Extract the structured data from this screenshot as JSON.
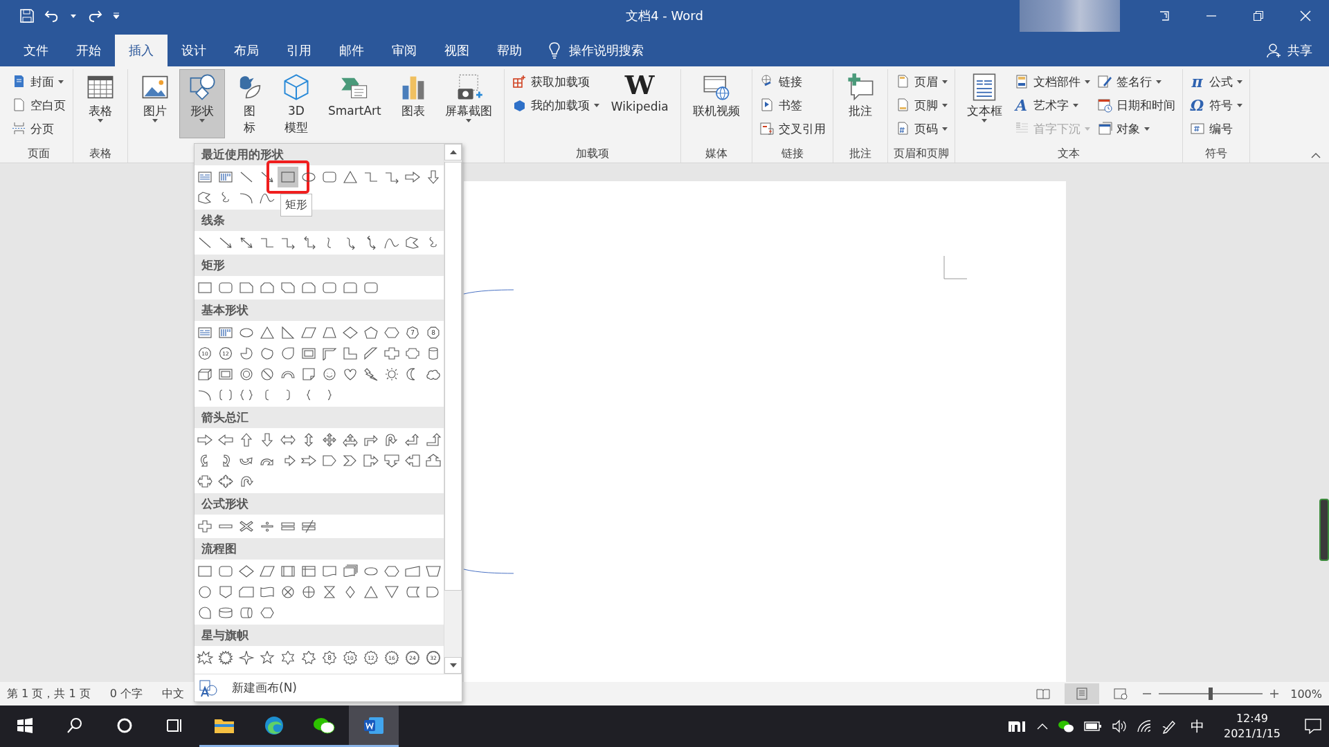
{
  "title_bar": {
    "title": "文档4 - Word"
  },
  "tabs": [
    {
      "label": "文件",
      "selected": false
    },
    {
      "label": "开始",
      "selected": false
    },
    {
      "label": "插入",
      "selected": true
    },
    {
      "label": "设计",
      "selected": false
    },
    {
      "label": "布局",
      "selected": false
    },
    {
      "label": "引用",
      "selected": false
    },
    {
      "label": "邮件",
      "selected": false
    },
    {
      "label": "审阅",
      "selected": false
    },
    {
      "label": "视图",
      "selected": false
    },
    {
      "label": "帮助",
      "selected": false
    }
  ],
  "tell_me": {
    "label": "操作说明搜索"
  },
  "share": {
    "label": "共享"
  },
  "ribbon": {
    "groups": [
      {
        "label": "页面",
        "columns": [
          {
            "items": [
              {
                "label": "封面",
                "kind": "document",
                "dropdown": true,
                "disabled": false
              },
              {
                "label": "空白页",
                "kind": "blank-page",
                "dropdown": false,
                "disabled": false
              },
              {
                "label": "分页",
                "kind": "page-break",
                "dropdown": false,
                "disabled": false
              }
            ]
          }
        ]
      },
      {
        "label": "表格",
        "columns": [
          {
            "kind": "grid",
            "label": "表格",
            "dropdown": true,
            "pressed": false
          }
        ]
      },
      {
        "columns": [
          {
            "kind": "landscape",
            "label": "图片",
            "dropdown": true,
            "pressed": false
          },
          {
            "kind": "shapes",
            "label": "形状",
            "dropdown": true,
            "pressed": true
          },
          {
            "kind": "bird",
            "lines": [
              "图",
              "标"
            ],
            "dropdown": false,
            "pressed": false
          },
          {
            "kind": "cube",
            "lines": [
              "3D",
              "模型"
            ],
            "dropdown": false,
            "pressed": false
          },
          {
            "kind": "diagram",
            "label": "SmartArt",
            "dropdown": false,
            "pressed": false
          },
          {
            "kind": "bar-chart",
            "label": "图表",
            "dropdown": false,
            "pressed": false
          },
          {
            "kind": "camera",
            "label": "屏幕截图",
            "dropdown": true,
            "pressed": false
          }
        ]
      },
      {
        "label": "加载项",
        "columns": [
          {
            "items": [
              {
                "label": "获取加载项",
                "kind": "store",
                "dropdown": false,
                "disabled": false
              },
              {
                "label": "我的加载项",
                "kind": "blocks",
                "dropdown": true,
                "disabled": false
              }
            ]
          },
          {
            "kind": "glyph",
            "glyph": "W",
            "label": "Wikipedia",
            "dropdown": false,
            "pressed": false
          }
        ]
      },
      {
        "label": "媒体",
        "columns": [
          {
            "kind": "film-globe",
            "label": "联机视频",
            "dropdown": false,
            "pressed": false
          }
        ]
      },
      {
        "label": "链接",
        "columns": [
          {
            "items": [
              {
                "label": "链接",
                "kind": "globe-link",
                "dropdown": false,
                "disabled": false
              },
              {
                "label": "书签",
                "kind": "bookmark",
                "dropdown": false,
                "disabled": false
              },
              {
                "label": "交叉引用",
                "kind": "cross-reference",
                "dropdown": false,
                "disabled": false
              }
            ]
          }
        ]
      },
      {
        "label": "批注",
        "columns": [
          {
            "kind": "comment-plus",
            "label": "批注",
            "dropdown": false,
            "pressed": false
          }
        ]
      },
      {
        "label": "页眉和页脚",
        "columns": [
          {
            "items": [
              {
                "label": "页眉",
                "kind": "page-header",
                "dropdown": true,
                "disabled": false
              },
              {
                "label": "页脚",
                "kind": "page-footer",
                "dropdown": true,
                "disabled": false
              },
              {
                "label": "页码",
                "kind": "page-number",
                "dropdown": true,
                "disabled": false
              }
            ]
          }
        ]
      },
      {
        "label": "文本",
        "columns": [
          {
            "kind": "text-box",
            "label": "文本框",
            "dropdown": true,
            "pressed": false
          },
          {
            "items": [
              {
                "label": "文档部件",
                "kind": "page-parts",
                "dropdown": true,
                "disabled": false
              },
              {
                "label": "艺术字",
                "kind": "glyph",
                "glyph": "A",
                "dropdown": true,
                "disabled": false
              },
              {
                "label": "首字下沉",
                "kind": "drop-cap",
                "dropdown": true,
                "disabled": true
              }
            ]
          },
          {
            "items": [
              {
                "label": "签名行",
                "kind": "pen",
                "dropdown": true,
                "disabled": false
              },
              {
                "label": "日期和时间",
                "kind": "calendar",
                "dropdown": false,
                "disabled": false
              },
              {
                "label": "对象",
                "kind": "window",
                "dropdown": true,
                "disabled": false
              }
            ]
          }
        ]
      },
      {
        "label": "符号",
        "columns": [
          {
            "items": [
              {
                "label": "公式",
                "kind": "glyph",
                "glyph": "π",
                "dropdown": true,
                "disabled": false
              },
              {
                "label": "符号",
                "kind": "glyph",
                "glyph": "Ω",
                "dropdown": true,
                "disabled": false
              },
              {
                "label": "编号",
                "kind": "number-box",
                "dropdown": false,
                "disabled": false
              }
            ]
          }
        ]
      }
    ]
  },
  "shapes_menu": {
    "tooltip": "矩形",
    "footer": "新建画布(N)",
    "sections": [
      {
        "title": "最近使用的形状",
        "shapes": [
          {
            "kind": "textbox",
            "selected": false
          },
          {
            "kind": "vtextbox",
            "selected": false
          },
          {
            "kind": "line",
            "selected": false
          },
          {
            "kind": "arrow-line",
            "selected": false
          },
          {
            "kind": "rect",
            "selected": true
          },
          {
            "kind": "oval",
            "selected": false
          },
          {
            "kind": "rounded-rect",
            "selected": false
          },
          {
            "kind": "triangle",
            "selected": false
          },
          {
            "kind": "elbow",
            "selected": false
          },
          {
            "kind": "elbow-arrow",
            "selected": false
          },
          {
            "kind": "right-arrow",
            "selected": false
          },
          {
            "kind": "down-arrow",
            "selected": false
          },
          {
            "kind": "freeform",
            "selected": false
          },
          {
            "kind": "scribble",
            "selected": false
          },
          {
            "kind": "arc",
            "selected": false
          },
          {
            "kind": "curve",
            "selected": false
          }
        ]
      },
      {
        "title": "线条",
        "shapes": [
          {
            "kind": "line",
            "selected": false
          },
          {
            "kind": "arrow-line",
            "selected": false
          },
          {
            "kind": "double-arrow-line",
            "selected": false
          },
          {
            "kind": "elbow",
            "selected": false
          },
          {
            "kind": "elbow-arrow",
            "selected": false
          },
          {
            "kind": "elbow-double-arrow",
            "selected": false
          },
          {
            "kind": "curve-conn",
            "selected": false
          },
          {
            "kind": "curve-arrow",
            "selected": false
          },
          {
            "kind": "curve-double-arrow",
            "selected": false
          },
          {
            "kind": "curve",
            "selected": false
          },
          {
            "kind": "freeform",
            "selected": false
          },
          {
            "kind": "scribble",
            "selected": false
          }
        ]
      },
      {
        "title": "矩形",
        "shapes": [
          {
            "kind": "rect",
            "selected": false
          },
          {
            "kind": "rounded-rect",
            "selected": false
          },
          {
            "kind": "snip1",
            "selected": false
          },
          {
            "kind": "snip2",
            "selected": false
          },
          {
            "kind": "snip-diag",
            "selected": false
          },
          {
            "kind": "snip-round",
            "selected": false
          },
          {
            "kind": "rounded-rect",
            "selected": false
          },
          {
            "kind": "round2",
            "selected": false
          },
          {
            "kind": "rounded-rect",
            "selected": false
          }
        ]
      },
      {
        "title": "基本形状",
        "shapes": [
          {
            "kind": "textbox",
            "selected": false
          },
          {
            "kind": "vtextbox",
            "selected": false
          },
          {
            "kind": "oval",
            "selected": false
          },
          {
            "kind": "triangle",
            "selected": false
          },
          {
            "kind": "right-triangle",
            "selected": false
          },
          {
            "kind": "parallelogram",
            "selected": false
          },
          {
            "kind": "trapezoid",
            "selected": false
          },
          {
            "kind": "diamond",
            "selected": false
          },
          {
            "kind": "pentagon",
            "selected": false
          },
          {
            "kind": "hexagon",
            "selected": false
          },
          {
            "kind": "heptagon",
            "label": "7",
            "selected": false
          },
          {
            "kind": "octagon",
            "label": "8",
            "selected": false
          },
          {
            "kind": "decagon",
            "label": "10",
            "selected": false
          },
          {
            "kind": "dodecagon",
            "label": "12",
            "selected": false
          },
          {
            "kind": "pie",
            "selected": false
          },
          {
            "kind": "chord",
            "selected": false
          },
          {
            "kind": "teardrop",
            "selected": false
          },
          {
            "kind": "frame",
            "selected": false
          },
          {
            "kind": "half-frame",
            "selected": false
          },
          {
            "kind": "l-shape",
            "selected": false
          },
          {
            "kind": "diag-stripe",
            "selected": false
          },
          {
            "kind": "cross",
            "selected": false
          },
          {
            "kind": "plaque",
            "selected": false
          },
          {
            "kind": "can",
            "selected": false
          },
          {
            "kind": "cube",
            "selected": false
          },
          {
            "kind": "bevel",
            "selected": false
          },
          {
            "kind": "donut",
            "selected": false
          },
          {
            "kind": "no-symbol",
            "selected": false
          },
          {
            "kind": "block-arc",
            "selected": false
          },
          {
            "kind": "folded-corner",
            "selected": false
          },
          {
            "kind": "smiley",
            "selected": false
          },
          {
            "kind": "heart",
            "selected": false
          },
          {
            "kind": "lightning",
            "selected": false
          },
          {
            "kind": "sun",
            "selected": false
          },
          {
            "kind": "moon",
            "selected": false
          },
          {
            "kind": "cloud",
            "selected": false
          },
          {
            "kind": "arc",
            "selected": false
          },
          {
            "kind": "bracket-pair",
            "selected": false
          },
          {
            "kind": "brace-pair",
            "selected": false
          },
          {
            "kind": "left-bracket",
            "selected": false
          },
          {
            "kind": "right-bracket",
            "selected": false
          },
          {
            "kind": "left-brace",
            "selected": false
          },
          {
            "kind": "right-brace",
            "selected": false
          }
        ]
      },
      {
        "title": "箭头总汇",
        "shapes": [
          {
            "kind": "right-arrow",
            "selected": false
          },
          {
            "kind": "left-arrow",
            "selected": false
          },
          {
            "kind": "up-arrow",
            "selected": false
          },
          {
            "kind": "down-arrow",
            "selected": false
          },
          {
            "kind": "left-right-arrow",
            "selected": false
          },
          {
            "kind": "up-down-arrow",
            "selected": false
          },
          {
            "kind": "quad-arrow",
            "selected": false
          },
          {
            "kind": "left-right-up-arrow",
            "selected": false
          },
          {
            "kind": "bent-arrow",
            "selected": false
          },
          {
            "kind": "u-turn-arrow",
            "selected": false
          },
          {
            "kind": "left-up-arrow",
            "selected": false
          },
          {
            "kind": "bent-up-arrow",
            "selected": false
          },
          {
            "kind": "curved-right-arrow",
            "selected": false
          },
          {
            "kind": "curved-left-arrow",
            "selected": false
          },
          {
            "kind": "curved-up-arrow",
            "selected": false
          },
          {
            "kind": "curved-down-arrow",
            "selected": false
          },
          {
            "kind": "striped-right-arrow",
            "selected": false
          },
          {
            "kind": "notched-right-arrow",
            "selected": false
          },
          {
            "kind": "pentagon-arrow",
            "selected": false
          },
          {
            "kind": "chevron",
            "selected": false
          },
          {
            "kind": "right-callout",
            "selected": false
          },
          {
            "kind": "down-callout",
            "selected": false
          },
          {
            "kind": "left-callout",
            "selected": false
          },
          {
            "kind": "up-callout",
            "selected": false
          },
          {
            "kind": "left-right-callout",
            "selected": false
          },
          {
            "kind": "quad-callout",
            "selected": false
          },
          {
            "kind": "circular-arrow",
            "selected": false
          }
        ]
      },
      {
        "title": "公式形状",
        "shapes": [
          {
            "kind": "plus",
            "selected": false
          },
          {
            "kind": "minus",
            "selected": false
          },
          {
            "kind": "multiply",
            "selected": false
          },
          {
            "kind": "divide",
            "selected": false
          },
          {
            "kind": "equal",
            "selected": false
          },
          {
            "kind": "not-equal",
            "selected": false
          }
        ]
      },
      {
        "title": "流程图",
        "shapes": [
          {
            "kind": "rect",
            "selected": false
          },
          {
            "kind": "rounded-rect",
            "selected": false
          },
          {
            "kind": "diamond",
            "selected": false
          },
          {
            "kind": "parallelogram",
            "selected": false
          },
          {
            "kind": "predefined",
            "selected": false
          },
          {
            "kind": "internal-storage",
            "selected": false
          },
          {
            "kind": "document",
            "selected": false
          },
          {
            "kind": "multidoc",
            "selected": false
          },
          {
            "kind": "terminator",
            "selected": false
          },
          {
            "kind": "hexagon",
            "selected": false
          },
          {
            "kind": "manual-input",
            "selected": false
          },
          {
            "kind": "manual-op",
            "selected": false
          },
          {
            "kind": "connector",
            "selected": false
          },
          {
            "kind": "offpage",
            "selected": false
          },
          {
            "kind": "card",
            "selected": false
          },
          {
            "kind": "punched-tape",
            "selected": false
          },
          {
            "kind": "summing-junction",
            "selected": false
          },
          {
            "kind": "or",
            "selected": false
          },
          {
            "kind": "collate",
            "selected": false
          },
          {
            "kind": "sort",
            "selected": false
          },
          {
            "kind": "triangle",
            "selected": false
          },
          {
            "kind": "merge",
            "selected": false
          },
          {
            "kind": "stored-data",
            "selected": false
          },
          {
            "kind": "delay",
            "selected": false
          },
          {
            "kind": "seq-storage",
            "selected": false
          },
          {
            "kind": "magnetic-disk",
            "selected": false
          },
          {
            "kind": "direct-access",
            "selected": false
          },
          {
            "kind": "display",
            "selected": false
          }
        ]
      },
      {
        "title": "星与旗帜",
        "shapes": [
          {
            "kind": "explosion",
            "selected": false
          },
          {
            "kind": "explosion2",
            "selected": false
          },
          {
            "kind": "star4",
            "selected": false
          },
          {
            "kind": "star5",
            "selected": false
          },
          {
            "kind": "star6",
            "selected": false
          },
          {
            "kind": "star7",
            "selected": false
          },
          {
            "kind": "star8",
            "label": "8",
            "selected": false
          },
          {
            "kind": "star10",
            "label": "10",
            "selected": false
          },
          {
            "kind": "star12",
            "label": "12",
            "selected": false
          },
          {
            "kind": "star16",
            "label": "16",
            "selected": false
          },
          {
            "kind": "star24",
            "label": "24",
            "selected": false
          },
          {
            "kind": "star32",
            "label": "32",
            "selected": false
          }
        ]
      }
    ]
  },
  "status_bar": {
    "page": "第 1 页，共 1 页",
    "words": "0 个字",
    "language": "中文",
    "views": [
      {
        "kind": "read",
        "selected": false
      },
      {
        "kind": "print",
        "selected": true
      },
      {
        "kind": "web",
        "selected": false
      }
    ],
    "zoom": {
      "level": 0.5,
      "reading": "100%"
    }
  },
  "taskbar": {
    "apps": [
      {
        "kind": "start",
        "running": false,
        "active": false
      },
      {
        "kind": "search",
        "running": false,
        "active": false
      },
      {
        "kind": "ring",
        "running": false,
        "active": false
      },
      {
        "kind": "task-view",
        "running": false,
        "active": false
      },
      {
        "kind": "folder",
        "running": true,
        "active": false
      },
      {
        "kind": "browser",
        "running": true,
        "active": false
      },
      {
        "kind": "chat",
        "running": true,
        "active": false
      },
      {
        "kind": "word",
        "running": true,
        "active": true
      }
    ],
    "tray": {
      "ime": "中",
      "time": "12:49",
      "date": "2021/1/15"
    }
  }
}
